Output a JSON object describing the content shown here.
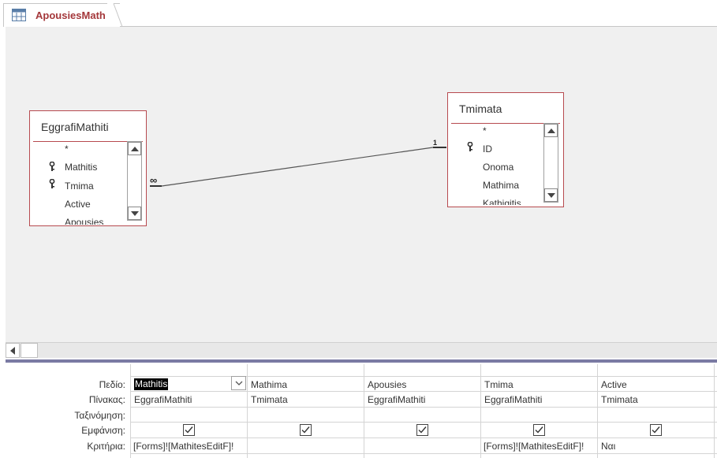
{
  "tab": {
    "title": "ApousiesMath"
  },
  "tables": [
    {
      "name": "EggrafiMathiti",
      "fields": [
        {
          "name": "*",
          "key": false
        },
        {
          "name": "Mathitis",
          "key": true
        },
        {
          "name": "Tmima",
          "key": true
        },
        {
          "name": "Active",
          "key": false
        },
        {
          "name": "Apousies",
          "key": false
        }
      ]
    },
    {
      "name": "Tmimata",
      "fields": [
        {
          "name": "*",
          "key": false
        },
        {
          "name": "ID",
          "key": true
        },
        {
          "name": "Onoma",
          "key": false
        },
        {
          "name": "Mathima",
          "key": false
        },
        {
          "name": "Kathigitis",
          "key": false
        }
      ]
    }
  ],
  "relationship": {
    "many_label": "∞",
    "one_label": "1"
  },
  "grid": {
    "row_labels": {
      "field": "Πεδίο:",
      "table": "Πίνακας:",
      "sort": "Ταξινόμηση:",
      "show": "Εμφάνιση:",
      "criteria": "Κριτήρια:"
    },
    "columns": [
      {
        "field": "Mathitis",
        "table": "EggrafiMathiti",
        "sort": "",
        "show": true,
        "criteria": "[Forms]![MathitesEditF]!"
      },
      {
        "field": "Mathima",
        "table": "Tmimata",
        "sort": "",
        "show": true,
        "criteria": ""
      },
      {
        "field": "Apousies",
        "table": "EggrafiMathiti",
        "sort": "",
        "show": true,
        "criteria": ""
      },
      {
        "field": "Tmima",
        "table": "EggrafiMathiti",
        "sort": "",
        "show": true,
        "criteria": "[Forms]![MathitesEditF]!"
      },
      {
        "field": "Active",
        "table": "Tmimata",
        "sort": "",
        "show": true,
        "criteria": "Ναι"
      }
    ]
  },
  "colors": {
    "accent": "#a4373a",
    "table_border": "#b74a4f",
    "splitter": "#7a7aa3"
  }
}
